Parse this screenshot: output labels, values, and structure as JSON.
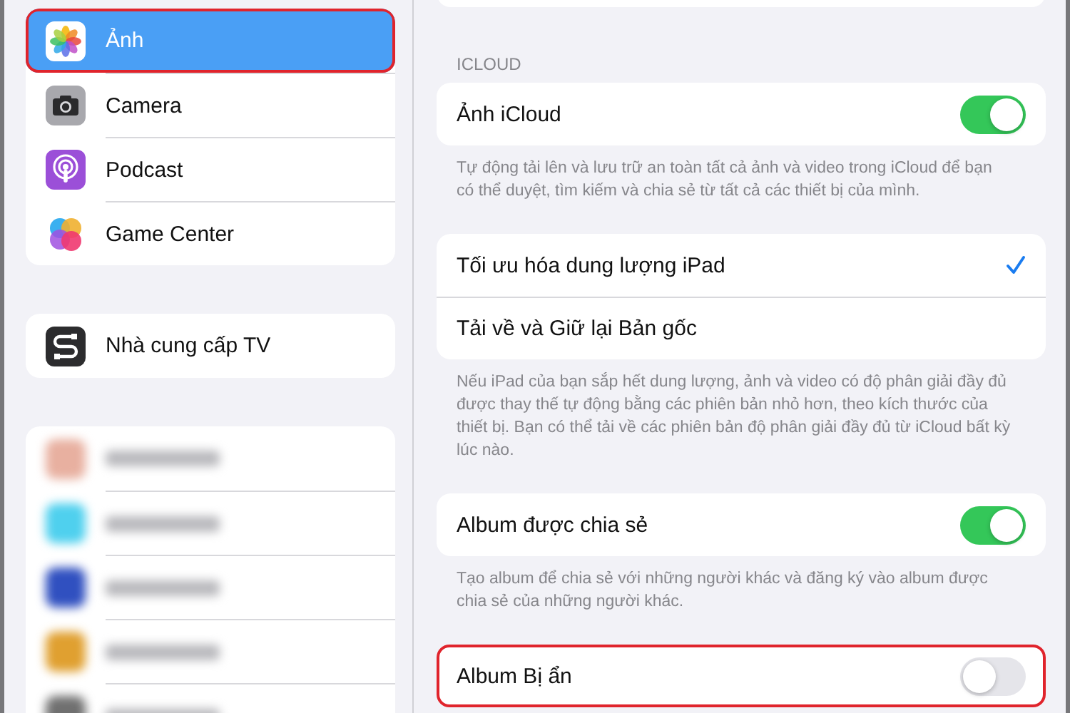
{
  "sidebar": {
    "groups": [
      {
        "items": [
          {
            "label": "Ảnh",
            "selected": true,
            "highlighted": true
          },
          {
            "label": "Camera",
            "selected": false,
            "highlighted": false
          },
          {
            "label": "Podcast",
            "selected": false,
            "highlighted": false
          },
          {
            "label": "Game Center",
            "selected": false,
            "highlighted": false
          }
        ]
      },
      {
        "items": [
          {
            "label": "Nhà cung cấp TV",
            "selected": false,
            "highlighted": false
          }
        ]
      }
    ],
    "blurred_apps": [
      {
        "color": "#e8b0a0"
      },
      {
        "color": "#4fd0ee"
      },
      {
        "color": "#3050c0"
      },
      {
        "color": "#e0a030"
      },
      {
        "color": "#707070"
      }
    ]
  },
  "content": {
    "sections": [
      {
        "header": "ICLOUD",
        "rows": [
          {
            "kind": "toggle",
            "label": "Ảnh iCloud",
            "on": true,
            "highlighted": false
          }
        ],
        "footer": "Tự động tải lên và lưu trữ an toàn tất cả ảnh và video trong iCloud để bạn có thể duyệt, tìm kiếm và chia sẻ từ tất cả các thiết bị của mình."
      },
      {
        "rows": [
          {
            "kind": "choice",
            "label": "Tối ưu hóa dung lượng iPad",
            "selected": true,
            "highlighted": false
          },
          {
            "kind": "choice",
            "label": "Tải về và Giữ lại Bản gốc",
            "selected": false,
            "highlighted": false
          }
        ],
        "footer": "Nếu iPad của bạn sắp hết dung lượng, ảnh và video có độ phân giải đầy đủ được thay thế tự động bằng các phiên bản nhỏ hơn, theo kích thước của thiết bị. Bạn có thể tải về các phiên bản độ phân giải đầy đủ từ iCloud bất kỳ lúc nào."
      },
      {
        "rows": [
          {
            "kind": "toggle",
            "label": "Album được chia sẻ",
            "on": true,
            "highlighted": false
          }
        ],
        "footer": "Tạo album để chia sẻ với những người khác và đăng ký vào album được chia sẻ của những người khác."
      },
      {
        "rows": [
          {
            "kind": "toggle",
            "label": "Album Bị ẩn",
            "on": false,
            "highlighted": true
          }
        ]
      }
    ]
  }
}
